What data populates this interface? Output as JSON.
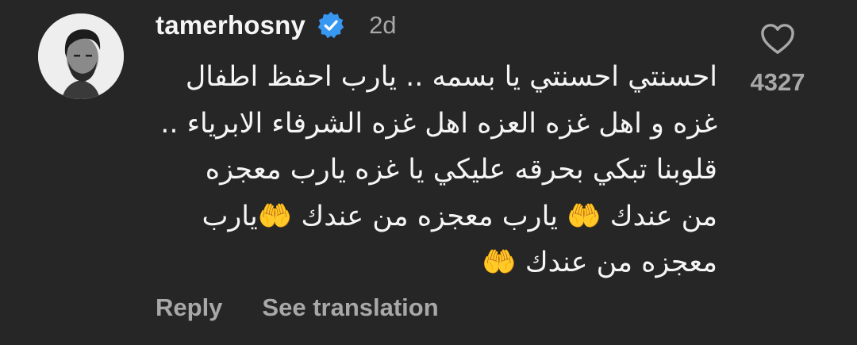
{
  "comment": {
    "username": "tamerhosny",
    "verified": true,
    "timestamp": "2d",
    "text_lines": [
      "احسنتي احسنتي يا بسمه .. يارب احفظ اطفال",
      "غزه و اهل غزه العزه  اهل غزه الشرفاء الابرياء ..",
      "قلوبنا تبكي بحرقه عليكي يا غزه  يارب معجزه",
      "من عندك 🤲 يارب معجزه من عندك 🤲يارب",
      "معجزه من عندك 🤲"
    ],
    "like_count": "4327",
    "actions": {
      "reply": "Reply",
      "see_translation": "See translation"
    }
  },
  "colors": {
    "background": "#262626",
    "primary_text": "#f5f5f5",
    "secondary_text": "#a8a8a8",
    "verified_badge": "#3897f0"
  },
  "icons": {
    "verified": "verified-badge-icon",
    "like": "heart-outline-icon",
    "avatar": "profile-photo"
  }
}
